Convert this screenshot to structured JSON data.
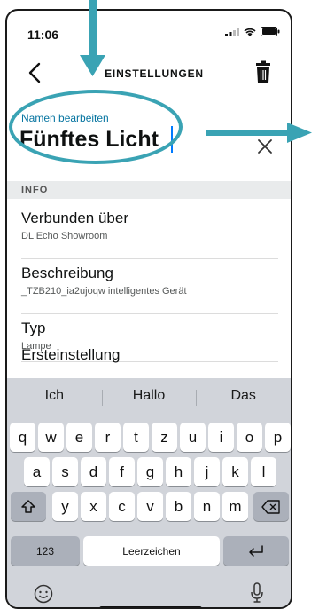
{
  "status": {
    "time": "11:06"
  },
  "header": {
    "title": "EINSTELLUNGEN"
  },
  "name_edit": {
    "label": "Namen bearbeiten",
    "value": "Fünftes Licht"
  },
  "section": {
    "label": "INFO"
  },
  "rows": [
    {
      "title": "Verbunden über",
      "subtitle": "DL Echo Showroom"
    },
    {
      "title": "Beschreibung",
      "subtitle": "_TZB210_ia2ujoqw intelligentes Gerät"
    },
    {
      "title": "Typ",
      "subtitle": "Lampe"
    },
    {
      "title": "Ersteinstellung"
    }
  ],
  "keyboard": {
    "suggestions": [
      "Ich",
      "Hallo",
      "Das"
    ],
    "row1": [
      "q",
      "w",
      "e",
      "r",
      "t",
      "z",
      "u",
      "i",
      "o",
      "p"
    ],
    "row2": [
      "a",
      "s",
      "d",
      "f",
      "g",
      "h",
      "j",
      "k",
      "l"
    ],
    "row3": [
      "y",
      "x",
      "c",
      "v",
      "b",
      "n",
      "m"
    ],
    "numbers_label": "123",
    "space_label": "Leerzeichen"
  },
  "colors": {
    "accent": "#0574a0",
    "annotation": "#3aa3b4"
  }
}
